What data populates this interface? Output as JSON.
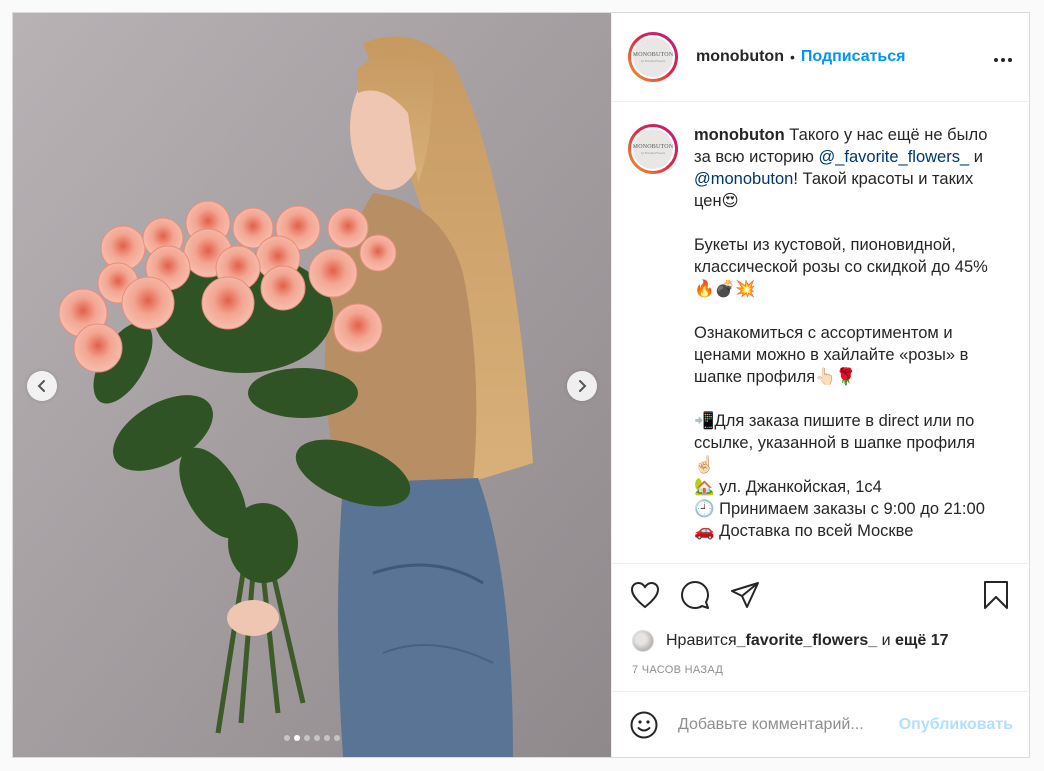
{
  "post": {
    "username": "monobuton",
    "separator": "•",
    "follow_label": "Подписаться",
    "more_label": "•••",
    "avatar_logo_text": "MONOBUTON",
    "avatar_logo_sub": "by Favorite Flowers"
  },
  "caption": {
    "username": "monobuton",
    "part1": " Такого у нас ещё не было за всю историю ",
    "mention1": "@_favorite_flowers_",
    "part2": " и ",
    "mention2": "@monobuton",
    "part3": "! Такой красоты и таких цен😍\n\nБукеты из кустовой, пионовидной, классической розы со скидкой до 45%🔥💣💥\n\nОзнакомиться с ассортиментом и ценами можно в хайлайте «розы» в шапке профиля👆🏻🌹\n\n📲Для заказа пишите в direct или по ссылке, указанной в шапке профиля☝🏻\n🏡 ул. Джанкойская, 1с4\n🕘 Принимаем заказы с 9:00 до 21:00\n🚗 Доставка по всей Москве"
  },
  "carousel": {
    "slide_count": 6,
    "active_index": 1
  },
  "likes": {
    "prefix": "Нравится ",
    "user": "_favorite_flowers_",
    "middle": " и ",
    "others": "ещё 17"
  },
  "timestamp": "7 ЧАСОВ НАЗАД",
  "comment": {
    "placeholder": "Добавьте комментарий...",
    "value": "",
    "publish_label": "Опубликовать"
  },
  "colors": {
    "accent": "#0095f6",
    "publish_disabled": "#b2dffc",
    "mention": "#00376b",
    "muted": "#8e8e8e"
  },
  "icons": [
    "chevron-left-icon",
    "chevron-right-icon",
    "heart-icon",
    "comment-icon",
    "share-icon",
    "bookmark-icon",
    "emoji-icon",
    "more-icon"
  ]
}
